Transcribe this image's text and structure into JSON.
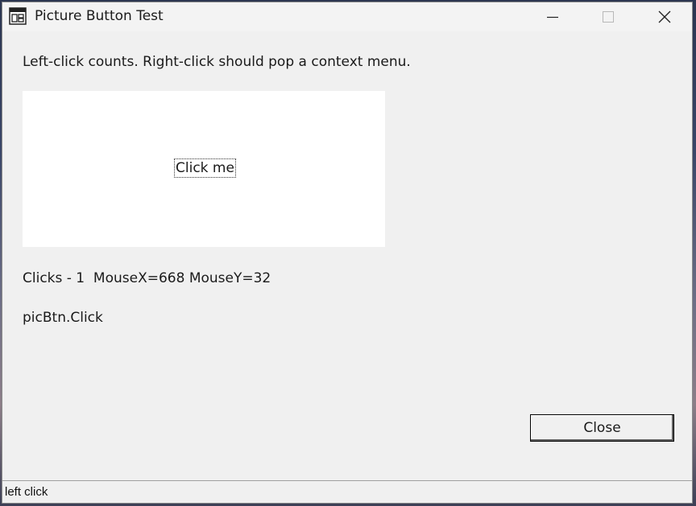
{
  "window": {
    "title": "Picture Button Test",
    "icon": "app-window-icon"
  },
  "titlebar_buttons": {
    "minimize": "minimize-icon",
    "maximize": "maximize-icon",
    "close": "close-icon"
  },
  "content": {
    "instructions": "Left-click counts. Right-click should pop a context menu.",
    "picture_button_label": "Click me",
    "clicks_status": "Clicks - 1  MouseX=668 MouseY=32",
    "last_event": "picBtn.Click",
    "close_button_label": "Close"
  },
  "statusbar": {
    "text": "left click"
  }
}
